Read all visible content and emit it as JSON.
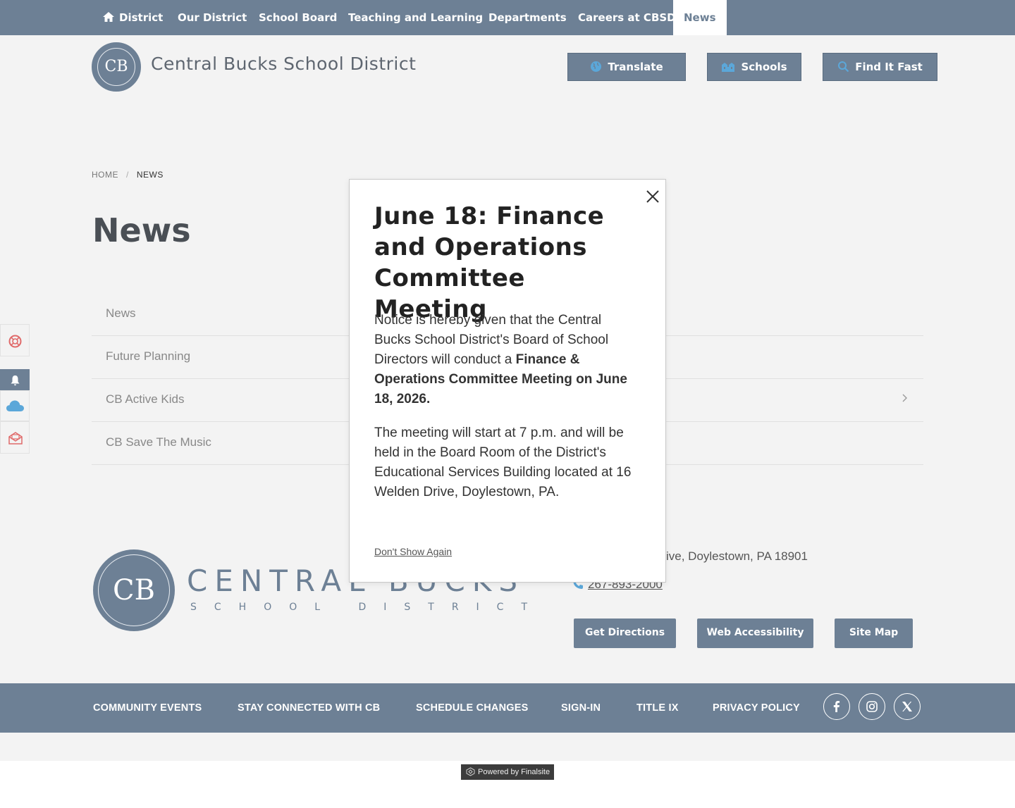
{
  "topnav": {
    "items": [
      {
        "label": "District"
      },
      {
        "label": "Our District"
      },
      {
        "label": "School Board"
      },
      {
        "label": "Teaching and Learning"
      },
      {
        "label": "Departments"
      },
      {
        "label": "Careers at CBSD"
      },
      {
        "label": "News",
        "active": true
      }
    ]
  },
  "header": {
    "logo_text": "CB",
    "site_name": "Central Bucks School District",
    "buttons": {
      "translate": "Translate",
      "schools": "Schools",
      "find_it_fast": "Find It Fast"
    }
  },
  "breadcrumb": {
    "home": "HOME",
    "separator": "/",
    "current": "NEWS"
  },
  "page_title": "News",
  "subnav": {
    "items": [
      {
        "label": "News"
      },
      {
        "label": "Future Planning"
      },
      {
        "label": "CB Active Kids"
      },
      {
        "label": "CB Save The Music"
      }
    ]
  },
  "sidebar": {
    "icons": [
      "lifebuoy-icon",
      "bell-icon",
      "cloud-icon",
      "mail-icon"
    ]
  },
  "modal": {
    "title": "June 18: Finance and Operations Committee Meeting",
    "p1_start": "Notice is hereby given that the Central Bucks School District's Board of School Directors will conduct a ",
    "p1_bold": "Finance & Operations Committee Meeting on June 18, 2026.",
    "p2": "The meeting will start at 7 p.m. and will be held in the Board Room of the District's Educational Services Building located at 16 Welden Drive, Doylestown, PA.",
    "dont_show": "Don't Show Again"
  },
  "footer": {
    "logo_text": "CB",
    "name": "CENTRAL BUCKS",
    "sub": "SCHOOL DISTRICT",
    "address_visible": "ive,  Doylestown, PA  18901",
    "phone": "267-893-2000",
    "buttons": {
      "directions": "Get Directions",
      "accessibility": "Web Accessibility",
      "sitemap": "Site Map"
    }
  },
  "footer_bar": {
    "links": [
      {
        "label": "COMMUNITY EVENTS"
      },
      {
        "label": "STAY CONNECTED WITH CB"
      },
      {
        "label": "SCHEDULE CHANGES"
      },
      {
        "label": "SIGN-IN"
      },
      {
        "label": "TITLE IX"
      },
      {
        "label": "PRIVACY POLICY"
      }
    ],
    "social": [
      "facebook-icon",
      "instagram-icon",
      "x-icon"
    ]
  },
  "powered_by": "Powered by Finalsite",
  "colors": {
    "brand": "#6d8095",
    "background": "#f3f3f3",
    "accent_icon": "#5ba7d9"
  }
}
